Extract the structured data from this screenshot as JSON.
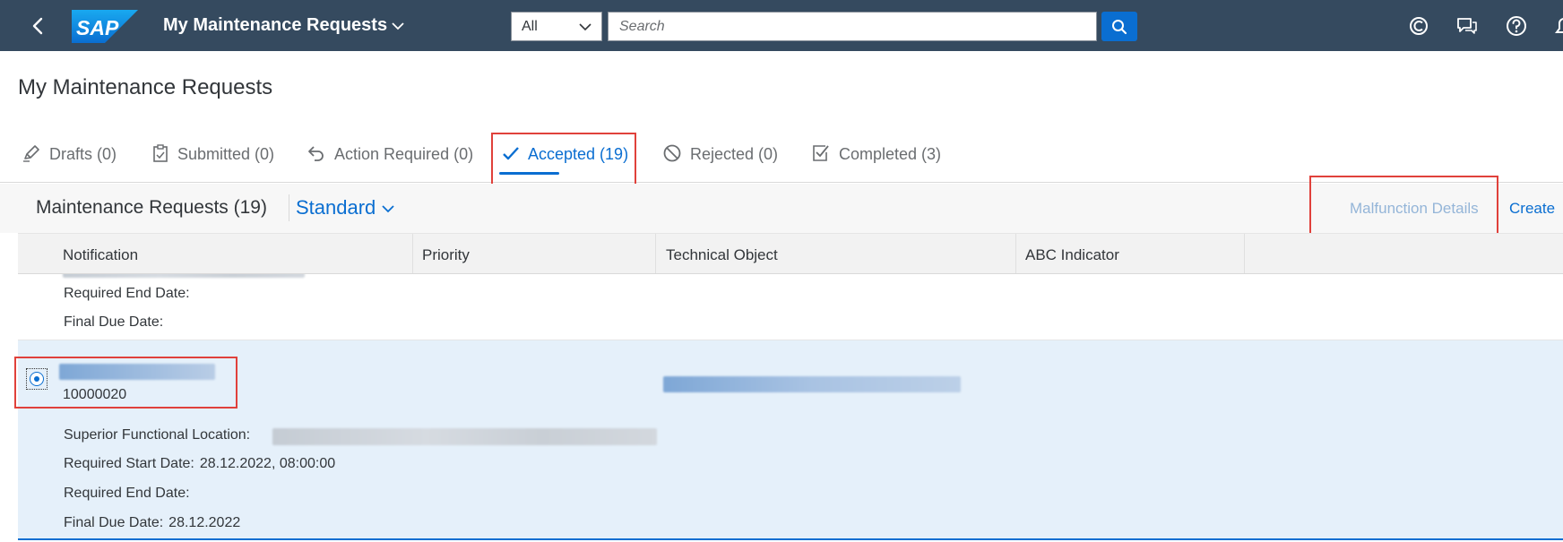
{
  "shell": {
    "app_title": "My Maintenance Requests",
    "scope_value": "All",
    "search_placeholder": "Search",
    "logo_text": "SAP"
  },
  "page": {
    "title": "My Maintenance Requests"
  },
  "tabs": [
    {
      "label": "Drafts (0)",
      "icon": "pencil-icon"
    },
    {
      "label": "Submitted (0)",
      "icon": "clipboard-icon"
    },
    {
      "label": "Action Required (0)",
      "icon": "undo-arrow-icon"
    },
    {
      "label": "Accepted (19)",
      "icon": "checkmark-icon",
      "active": true
    },
    {
      "label": "Rejected (0)",
      "icon": "prohibited-icon"
    },
    {
      "label": "Completed (3)",
      "icon": "checkbox-icon"
    }
  ],
  "table": {
    "title": "Maintenance Requests (19)",
    "variant": "Standard",
    "actions": {
      "malfunction_details": "Malfunction Details",
      "create": "Create"
    },
    "columns": [
      "Notification",
      "Priority",
      "Technical Object",
      "ABC Indicator"
    ],
    "rows": [
      {
        "labels": {
          "required_end_date": "Required End Date:",
          "final_due_date": "Final Due Date:"
        }
      },
      {
        "selected": true,
        "notification_id": "10000020",
        "labels": {
          "superior_functional_location": "Superior Functional Location:",
          "required_start_date": "Required Start Date:",
          "required_end_date": "Required End Date:",
          "final_due_date": "Final Due Date:"
        },
        "values": {
          "required_start_date": "28.12.2022, 08:00:00",
          "final_due_date": "28.12.2022"
        }
      }
    ]
  },
  "colors": {
    "shell": "#354a5f",
    "accent": "#0a6ed1",
    "selected_row": "#e5f0fa",
    "highlight": "#e0413b"
  }
}
